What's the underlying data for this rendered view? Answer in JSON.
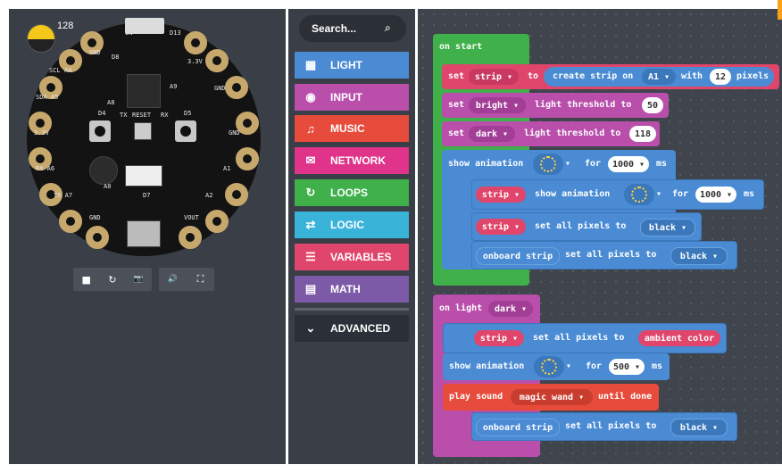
{
  "simulator": {
    "light_level": "128",
    "controls": [
      "■",
      "↻",
      "📷",
      "🔊",
      "⛶"
    ]
  },
  "board_labels": [
    "D8",
    "GND",
    "ON",
    "D13",
    "SCL A4",
    "3.3V",
    "GND",
    "A9",
    "SDA A5",
    "A8",
    "D4",
    "TX",
    "RESET",
    "RX",
    "D5",
    "3.3V",
    "GND",
    "A1",
    "RX A6",
    "A0",
    "D7",
    "TX A7",
    "GND",
    "A2",
    "VOUT"
  ],
  "toolbox": {
    "search_placeholder": "Search...",
    "categories": [
      {
        "label": "LIGHT",
        "icon": "grid-icon",
        "color": "#4a8bd4"
      },
      {
        "label": "INPUT",
        "icon": "target-icon",
        "color": "#b94fab"
      },
      {
        "label": "MUSIC",
        "icon": "headphones-icon",
        "color": "#e64b3b"
      },
      {
        "label": "NETWORK",
        "icon": "chat-icon",
        "color": "#e0338a"
      },
      {
        "label": "LOOPS",
        "icon": "loop-icon",
        "color": "#3fb04a"
      },
      {
        "label": "LOGIC",
        "icon": "shuffle-icon",
        "color": "#3ab3d9"
      },
      {
        "label": "VARIABLES",
        "icon": "list-icon",
        "color": "#e0466b"
      },
      {
        "label": "MATH",
        "icon": "calculator-icon",
        "color": "#7d5aa8"
      },
      {
        "label": "ADVANCED",
        "icon": "chevron-down-icon",
        "color": "#2b3038"
      }
    ]
  },
  "workspace": {
    "on_start": {
      "header": "on start",
      "set_strip": {
        "set": "set",
        "var": "strip ▾",
        "to": "to",
        "fn": "create strip on",
        "pin": "A1 ▾",
        "with": "with",
        "count": "12",
        "unit": "pixels"
      },
      "set_bright": {
        "set": "set",
        "var": "bright ▾",
        "fn": "light threshold to",
        "val": "50"
      },
      "set_dark": {
        "set": "set",
        "var": "dark ▾",
        "fn": "light threshold to",
        "val": "118"
      },
      "show_anim": {
        "label": "show animation",
        "icon": "▾",
        "for": "for",
        "val": "1000 ▾",
        "unit": "ms"
      },
      "strip_anim": {
        "var": "strip ▾",
        "label": "show animation",
        "icon": "▾",
        "for": "for",
        "val": "1000 ▾",
        "unit": "ms"
      },
      "strip_set": {
        "var": "strip ▾",
        "label": "set all pixels to",
        "color": "black ▾"
      },
      "onboard_set": {
        "var": "onboard strip",
        "label": "set all pixels to",
        "color": "black ▾"
      }
    },
    "on_light": {
      "header": "on light",
      "cond": "dark ▾",
      "strip_set": {
        "var": "strip ▾",
        "label": "set all pixels to",
        "color": "ambient color"
      },
      "show_anim": {
        "label": "show animation",
        "icon": "▾",
        "for": "for",
        "val": "500 ▾",
        "unit": "ms"
      },
      "play": {
        "label": "play sound",
        "sound": "magic wand ▾",
        "until": "until done"
      },
      "onboard_set": {
        "var": "onboard strip",
        "label": "set all pixels to",
        "color": "black ▾"
      }
    }
  }
}
